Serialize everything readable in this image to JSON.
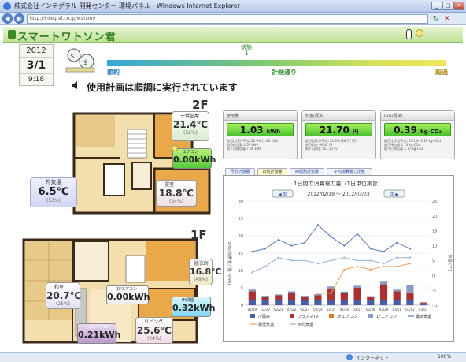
{
  "window": {
    "title": "株式会社インテグラル 開発センター 環境パネル - Windows Internet Explorer",
    "address": "http://integral.co.jp/watson/",
    "status_text": "インターネット",
    "zoom": "100%"
  },
  "header": {
    "app_name": "スマートワトソン君"
  },
  "date": {
    "year": "2012",
    "month_day": "3/1",
    "time": "9:18"
  },
  "plan": {
    "status_label": "状態",
    "left_label": "節約",
    "mid_label": "計画通り",
    "right_label": "超過",
    "message": "使用計画は順調に実行されています",
    "position": 0.5
  },
  "floors": {
    "upper": {
      "label": "2F",
      "sensors": [
        {
          "name": "子供部屋",
          "temp": "21.4℃",
          "humidity": "(32%)"
        },
        {
          "name": "寝室",
          "temp": "18.8℃",
          "humidity": "(34%)"
        }
      ],
      "power": [
        {
          "name": "エアコン",
          "value": "0.00kWh"
        }
      ]
    },
    "lower": {
      "label": "1F",
      "sensors": [
        {
          "name": "和室",
          "temp": "20.7℃",
          "humidity": "(25%)"
        },
        {
          "name": "脱衣所",
          "temp": "16.8℃",
          "humidity": "(49%)"
        },
        {
          "name": "リビング",
          "temp": "25.6℃",
          "humidity": "(24%)"
        }
      ],
      "power": [
        {
          "name": "1Fエアコン",
          "value": "0.00kWh"
        },
        {
          "name": "IH調理",
          "value": "0.32kWh"
        },
        {
          "name": "プラズマTV",
          "value": "0.21kWh"
        }
      ]
    }
  },
  "outdoor": {
    "label": "外気温",
    "temp": "6.5℃",
    "humidity": "(53%)"
  },
  "cards": [
    {
      "title": "使用量",
      "value": "1.03",
      "unit": "kWh",
      "lines": [
        "前日比(1月平均)  22.9% (1.84 kWh)",
        "前日使用量  4.59 kWh",
        "前＋日使用量  7.36 kWh"
      ]
    },
    {
      "title": "料金(概算)",
      "value": "21.70",
      "unit": "円",
      "lines": [
        "前日比(1月平均)  22.9% (28.72 円)",
        "前日料金  96.42 円",
        "前＋日料金  151.31 円"
      ]
    },
    {
      "title": "CO₂(概算)",
      "value": "0.39",
      "unit": "kg-CO₂",
      "lines": [
        "前日比(1月平均)  22.1% (1.39 kg-CO₂)",
        "前日排出量  1.74 kg-CO₂",
        "前＋日排出量  2.77 kg-CO₂"
      ]
    }
  ],
  "tabs": [
    "月別計測量",
    "日別計測量",
    "時間別計測量",
    "平均消費電力比較"
  ],
  "chart_data": {
    "type": "bar",
    "title": "1日間の消費電力量（1日単位集計）",
    "range_label": "2012/02/19 ～ 2012/03/03",
    "prev_label": "◀ 前",
    "next_label": "次 ▶",
    "ylabel": "日々の消費電力量 (kWh)",
    "y2label": "気温 (℃)",
    "ylim": [
      0,
      30
    ],
    "y2lim": [
      -10,
      25
    ],
    "yticks": [
      "30",
      "25",
      "20",
      "15",
      "10",
      "5",
      "0"
    ],
    "y2ticks": [
      "25",
      "20",
      "15",
      "10",
      "5",
      "0",
      "-5",
      "-10"
    ],
    "categories": [
      "02/19",
      "02/20",
      "02/21",
      "02/22",
      "02/23",
      "02/24",
      "02/25",
      "02/26",
      "02/27",
      "02/28",
      "02/29",
      "03/01",
      "03/02",
      "03/03"
    ],
    "series": [
      {
        "name": "冷蔵庫",
        "color": "#4a5ea8",
        "values": [
          1.5,
          1.4,
          1.4,
          1.5,
          1.5,
          1.4,
          1.6,
          1.5,
          1.5,
          1.4,
          1.5,
          1.5,
          1.4,
          0.5
        ]
      },
      {
        "name": "プラズマTV",
        "color": "#a83232",
        "values": [
          2.5,
          1.0,
          1.5,
          2.0,
          1.0,
          1.5,
          3.0,
          2.0,
          3.5,
          1.0,
          4.5,
          2.5,
          2.0,
          0.3
        ]
      },
      {
        "name": "2Fエアコン",
        "color": "#e07a2a",
        "values": [
          0,
          0,
          0,
          0,
          0,
          0,
          0,
          0,
          0,
          0,
          0,
          0,
          0,
          0
        ]
      },
      {
        "name": "1Fエアコン",
        "color": "#8a9ac8",
        "values": [
          0.5,
          0.3,
          0.2,
          0.5,
          0.2,
          0.3,
          0.8,
          0.4,
          0.6,
          0.2,
          1.0,
          0.5,
          2.5,
          0
        ]
      },
      {
        "name": "最高気温",
        "type": "line",
        "color": "#5a7ab8",
        "values": [
          8,
          9,
          12,
          10,
          11,
          17,
          13,
          10,
          14,
          9,
          8,
          11,
          9,
          null
        ]
      },
      {
        "name": "最低気温",
        "type": "line",
        "color": "#e8a060",
        "values": [
          null,
          null,
          null,
          null,
          null,
          -6,
          -6,
          2,
          3,
          2,
          3,
          3,
          4,
          null
        ]
      },
      {
        "name": "平均気温",
        "type": "line",
        "color": "#9ab0d0",
        "values": [
          1,
          3,
          6,
          5,
          5,
          4,
          5,
          6,
          5,
          5,
          4,
          6,
          6,
          null
        ]
      }
    ]
  }
}
